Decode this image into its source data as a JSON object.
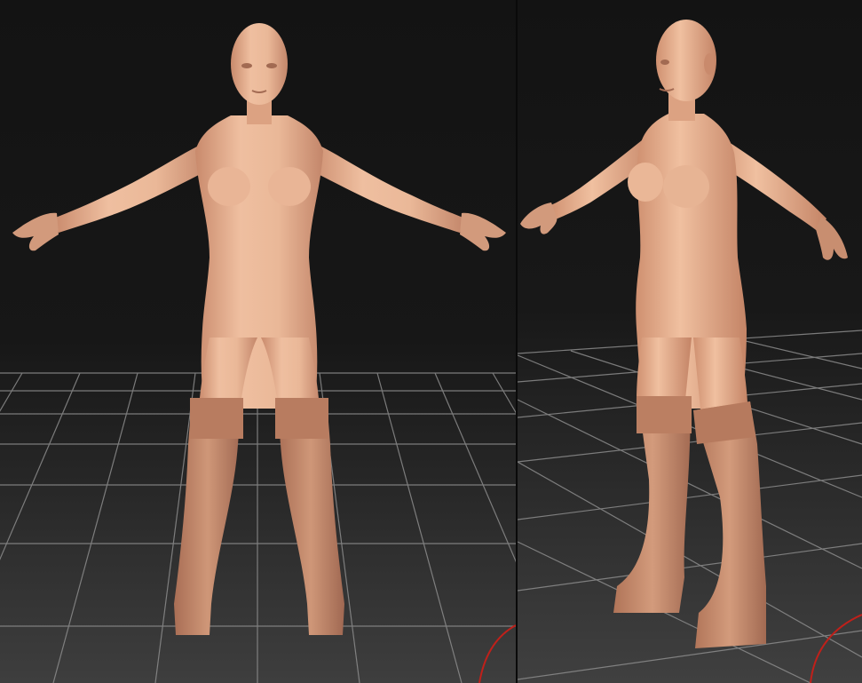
{
  "colors": {
    "background_top": "#141414",
    "background_floor": "#3a3a3a",
    "grid_line": "#8a8a8a",
    "skin_light": "#f0c0a0",
    "skin_mid": "#dca080",
    "skin_shadow": "#b8785c",
    "boot": "#c58a6d",
    "boot_shadow": "#9c6650",
    "gizmo_red": "#c0201a"
  },
  "views": [
    {
      "id": "front",
      "icon": "female-base-mesh-front-view"
    },
    {
      "id": "perspective",
      "icon": "female-base-mesh-perspective-view"
    }
  ]
}
